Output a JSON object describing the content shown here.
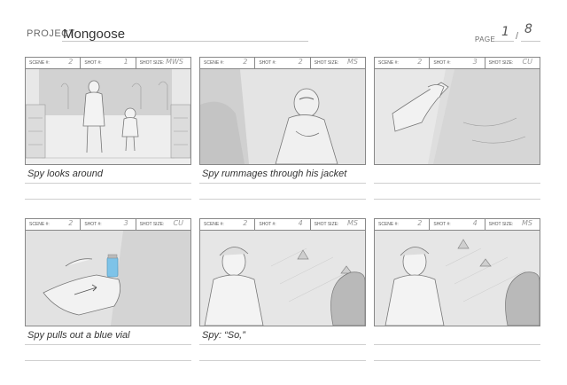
{
  "header": {
    "project_label": "PROJECT",
    "project_name": "Mongoose",
    "page_label": "PAGE",
    "page_current": "1",
    "page_separator": "/",
    "page_total": "8"
  },
  "field_labels": {
    "scene": "SCENE #:",
    "shot": "SHOT #:",
    "shot_size": "SHOT SIZE:"
  },
  "panels": [
    {
      "scene": "2",
      "shot": "1",
      "shot_size": "MWS",
      "caption": "Spy looks around"
    },
    {
      "scene": "2",
      "shot": "2",
      "shot_size": "MS",
      "caption": "Spy rummages through his jacket"
    },
    {
      "scene": "2",
      "shot": "3",
      "shot_size": "CU",
      "caption": ""
    },
    {
      "scene": "2",
      "shot": "3",
      "shot_size": "CU",
      "caption": "Spy pulls out a blue vial"
    },
    {
      "scene": "2",
      "shot": "4",
      "shot_size": "MS",
      "caption": "Spy: “So,”"
    },
    {
      "scene": "2",
      "shot": "4",
      "shot_size": "MS",
      "caption": ""
    }
  ],
  "colors": {
    "vial_blue": "#7ec3e8",
    "sketch_gray": "#8a8a8a"
  }
}
